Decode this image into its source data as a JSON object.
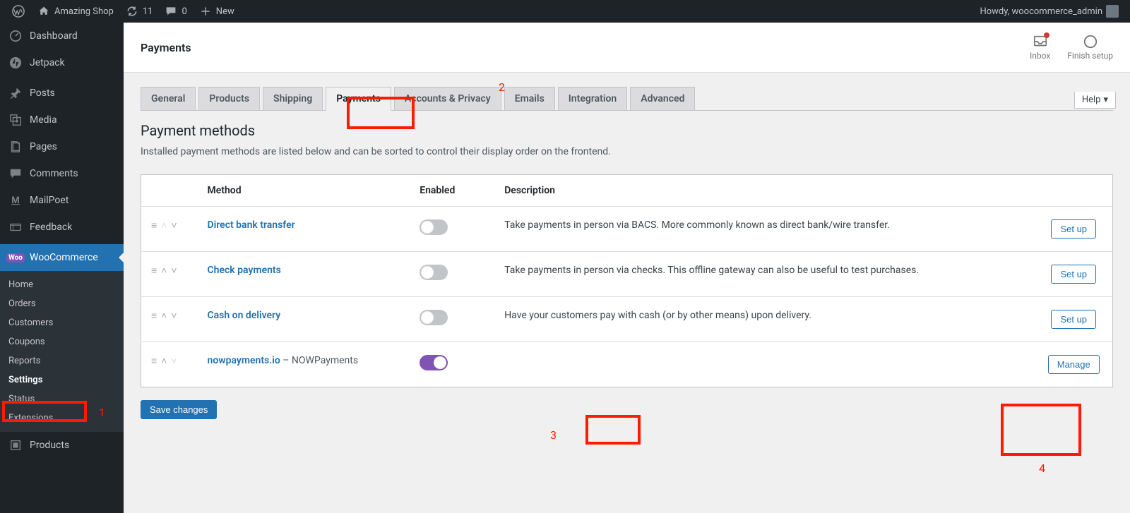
{
  "topbar": {
    "site_name": "Amazing Shop",
    "updates_count": "11",
    "comments_count": "0",
    "new_label": "New",
    "howdy": "Howdy, woocommerce_admin"
  },
  "sidebar": {
    "items": [
      {
        "icon": "dashboard",
        "label": "Dashboard"
      },
      {
        "icon": "jetpack",
        "label": "Jetpack"
      },
      {
        "icon": "pin",
        "label": "Posts"
      },
      {
        "icon": "media",
        "label": "Media"
      },
      {
        "icon": "page",
        "label": "Pages"
      },
      {
        "icon": "comment",
        "label": "Comments"
      },
      {
        "icon": "mailpoet",
        "label": "MailPoet"
      },
      {
        "icon": "feedback",
        "label": "Feedback"
      },
      {
        "icon": "woo",
        "label": "WooCommerce"
      },
      {
        "icon": "products",
        "label": "Products"
      }
    ],
    "woo_submenu": [
      {
        "label": "Home"
      },
      {
        "label": "Orders"
      },
      {
        "label": "Customers"
      },
      {
        "label": "Coupons"
      },
      {
        "label": "Reports"
      },
      {
        "label": "Settings"
      },
      {
        "label": "Status"
      },
      {
        "label": "Extensions"
      }
    ]
  },
  "header": {
    "title": "Payments",
    "inbox": "Inbox",
    "finish": "Finish setup",
    "help": "Help"
  },
  "tabs": {
    "general": "General",
    "products": "Products",
    "shipping": "Shipping",
    "payments": "Payments",
    "accounts": "Accounts & Privacy",
    "emails": "Emails",
    "integration": "Integration",
    "advanced": "Advanced"
  },
  "section": {
    "title": "Payment methods",
    "desc": "Installed payment methods are listed below and can be sorted to control their display order on the frontend."
  },
  "table": {
    "col_method": "Method",
    "col_enabled": "Enabled",
    "col_description": "Description",
    "rows": [
      {
        "name": "Direct bank transfer",
        "suffix": "",
        "enabled": false,
        "desc": "Take payments in person via BACS. More commonly known as direct bank/wire transfer.",
        "action": "Set up"
      },
      {
        "name": "Check payments",
        "suffix": "",
        "enabled": false,
        "desc": "Take payments in person via checks. This offline gateway can also be useful to test purchases.",
        "action": "Set up"
      },
      {
        "name": "Cash on delivery",
        "suffix": "",
        "enabled": false,
        "desc": "Have your customers pay with cash (or by other means) upon delivery.",
        "action": "Set up"
      },
      {
        "name": "nowpayments.io",
        "suffix": " – NOWPayments",
        "enabled": true,
        "desc": "",
        "action": "Manage"
      }
    ]
  },
  "buttons": {
    "save": "Save changes"
  },
  "annotations": {
    "n1": "1",
    "n2": "2",
    "n3": "3",
    "n4": "4"
  }
}
